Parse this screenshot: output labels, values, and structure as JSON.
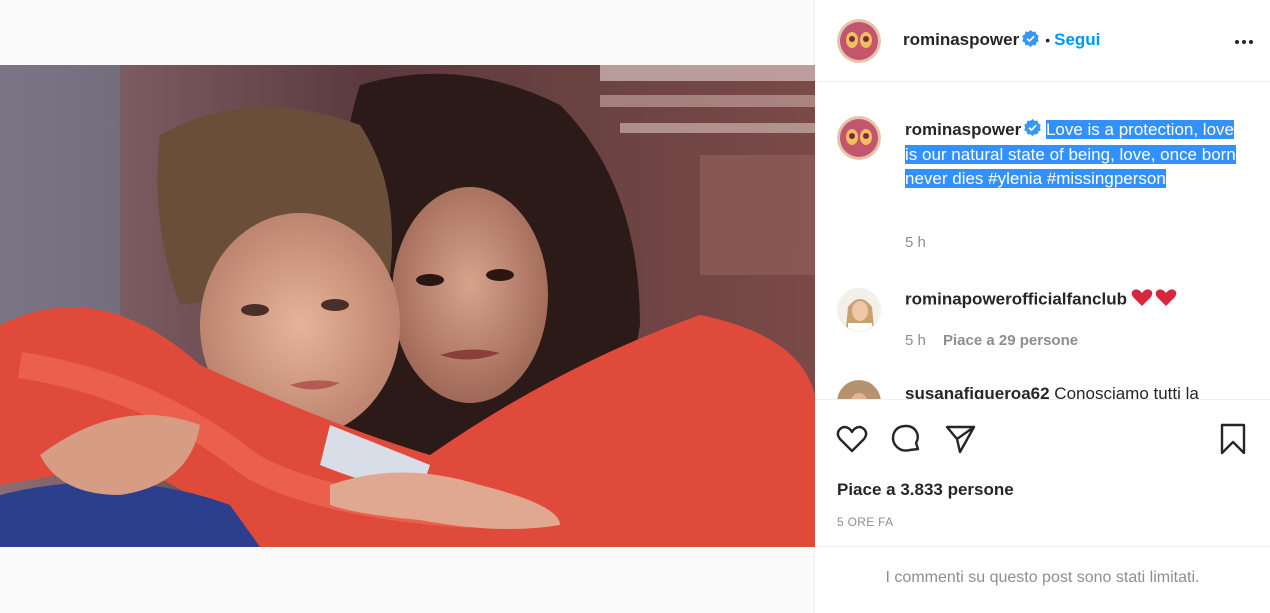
{
  "post": {
    "username": "rominaspower",
    "follow_label": "Segui",
    "separator": "•",
    "caption_text": "Love is a protection, love is our natural state of being, love, once born never dies #ylenia #missingperson",
    "caption_time": "5 h",
    "comments": [
      {
        "username": "rominapowerofficialfanclub",
        "text": "❤️❤️",
        "time": "5 h",
        "likes": "Piace a 29 persone"
      },
      {
        "username": "susanafigueroa62",
        "text": "Conosciamo tutti la"
      }
    ],
    "likes_text": "Piace a 3.833 persone",
    "date_text": "5 ORE FA",
    "comments_limited": "I commenti su questo post sono stati limitati."
  },
  "icons": [
    "verified-badge-icon",
    "more-options-icon",
    "like-heart-icon",
    "comment-icon",
    "share-icon",
    "save-bookmark-icon"
  ],
  "colors": {
    "link_blue": "#0095f6",
    "verified_blue": "#3897f0",
    "selection": "#3390ff",
    "muted": "#8e8e8e"
  }
}
